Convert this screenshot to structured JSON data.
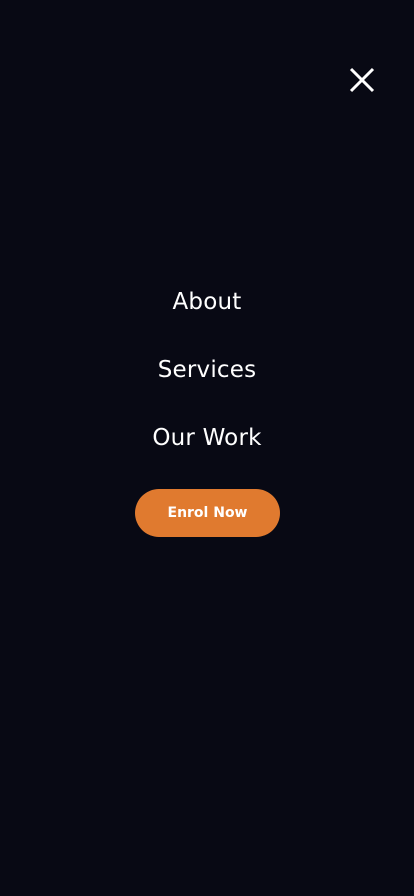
{
  "menu": {
    "close_icon": "close-icon",
    "links": [
      {
        "label": "About"
      },
      {
        "label": "Services"
      },
      {
        "label": "Our Work"
      }
    ],
    "cta_label": "Enrol Now"
  },
  "colors": {
    "background": "#080914",
    "text": "#ffffff",
    "accent": "#E07A2F"
  }
}
